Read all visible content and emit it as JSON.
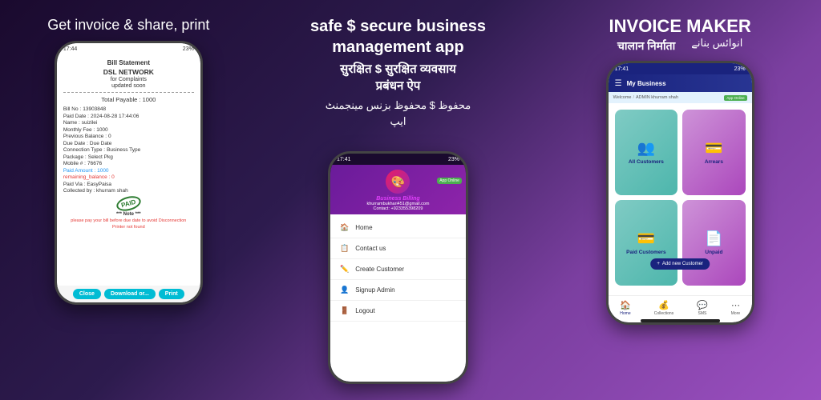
{
  "section1": {
    "title": "Get invoice & share, print",
    "statusBar": {
      "time": "17:44",
      "battery": "23%"
    },
    "bill": {
      "title": "Bill Statement",
      "subtitle": "DSL NETWORK",
      "sub2": "for Complaints",
      "sub3": "updated soon",
      "totalLabel": "Total Payable : 1000",
      "rows": [
        {
          "label": "Bill No : ",
          "value": "13903848"
        },
        {
          "label": "Paid Date : ",
          "value": "2024-08-28 17:44:06"
        },
        {
          "label": "Name : ",
          "value": "suizilei"
        },
        {
          "label": "Monthly Fee : ",
          "value": "1000"
        },
        {
          "label": "Previous Balance : ",
          "value": "0"
        },
        {
          "label": "Due Date : ",
          "value": "Due Date"
        },
        {
          "label": "Connection Type : ",
          "value": "Business Type"
        },
        {
          "label": "Package : ",
          "value": "Select Pkg"
        },
        {
          "label": "Mobile # : ",
          "value": "76676"
        }
      ],
      "paidAmount": "Paid Amount : 1000",
      "remaining": "remaining_balance : 0",
      "paidVia": "Paid Via :  EasyPaisa",
      "collectedBy": "Collected by : khurram shah",
      "stampText": "PAID",
      "note": "*** Note ***",
      "warning": "please pay your bill before due date to avoid Disconnection",
      "printerNotFound": "Printer not found",
      "buttons": {
        "close": "Close",
        "download": "Download or...",
        "print": "Print"
      }
    }
  },
  "section2": {
    "line1": "safe $ secure business",
    "line2": "management  app",
    "line3": "सुरक्षित $ सुरक्षित व्यवसाय",
    "line4": "प्रबंधन ऐप",
    "line5": "محفوظ $ محفوظ بزنس مینجمنٹ",
    "line6": "ایپ",
    "phone": {
      "statusBar": {
        "time": "17:41",
        "battery": "23%"
      },
      "header": {
        "logoEmoji": "🎨",
        "bizName": "Business Billing",
        "email": "khurrambukhari451@gmail.com",
        "contact": "Contact: +923355398209",
        "appOnline": "App Online"
      },
      "menuItems": [
        {
          "icon": "🏠",
          "label": "Home"
        },
        {
          "icon": "📋",
          "label": "Contact us"
        },
        {
          "icon": "✏️",
          "label": "Create Customer"
        },
        {
          "icon": "👤",
          "label": "Signup Admin"
        },
        {
          "icon": "🚪",
          "label": "Logout"
        }
      ]
    }
  },
  "section3": {
    "titleEN": "INVOICE MAKER",
    "titleHindi": "चालान निर्माता",
    "titleUrdu": "انوائس بنانے",
    "phone": {
      "statusBar": {
        "time": "17:41",
        "battery": "23%"
      },
      "header": {
        "title": "My Business"
      },
      "subheader": {
        "welcome": "Welcome",
        "user": "ADMIN khurram shah",
        "appOnline": "App Online"
      },
      "cards": [
        {
          "icon": "👥",
          "label": "All Customers",
          "style": "teal"
        },
        {
          "icon": "💳",
          "label": "Arrears",
          "style": "purple"
        },
        {
          "icon": "💳",
          "label": "Paid Customers",
          "style": "teal"
        },
        {
          "icon": "📄",
          "label": "Unpaid",
          "style": "purple"
        }
      ],
      "fab": "Add new Customer",
      "bottomNav": [
        {
          "icon": "🏠",
          "label": "Home",
          "active": true
        },
        {
          "icon": "💰",
          "label": "Collections"
        },
        {
          "icon": "💬",
          "label": "SMS"
        },
        {
          "icon": "⋯",
          "label": "More"
        }
      ]
    }
  }
}
